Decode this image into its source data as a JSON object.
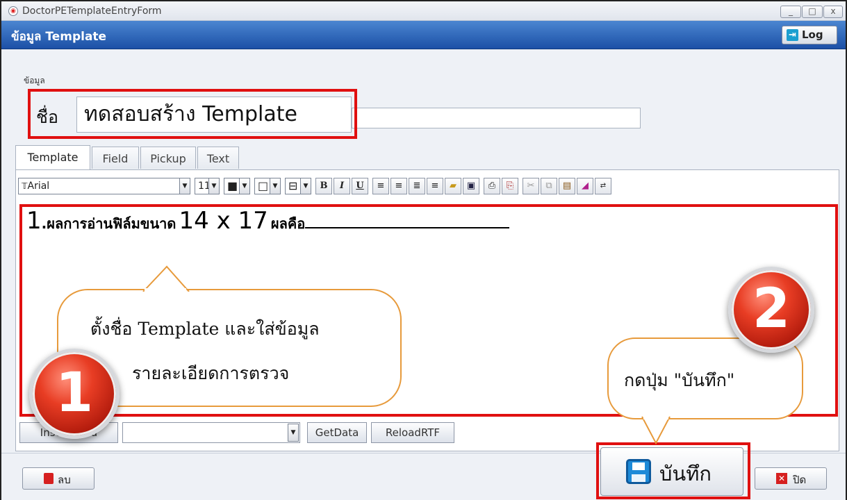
{
  "window": {
    "title": "DoctorPETemplateEntryForm",
    "controls": [
      "_",
      "□",
      "x"
    ]
  },
  "header": {
    "title": "ข้อมูล Template",
    "log_label": "Log"
  },
  "form": {
    "group_label": "ข้อมูล",
    "name_label": "ชื่อ",
    "name_value": "ทดสอบสร้าง Template"
  },
  "tabs": [
    {
      "label": "Template"
    },
    {
      "label": "Field"
    },
    {
      "label": "Pickup"
    },
    {
      "label": "Text"
    }
  ],
  "toolbar": {
    "font_name": "Arial",
    "font_size": "11",
    "bold": "B",
    "italic": "I",
    "underline": "U"
  },
  "editor": {
    "number": "1",
    "thai_1": ".ผลการอ่านฟิล์มขนาด",
    "size": "14 x 17",
    "thai_2": "ผลคือ"
  },
  "callouts": {
    "step1_line1": "ตั้งชื่อ Template และใส่ข้อมูล",
    "step1_line2": "รายละเอียดการตรวจ",
    "step2_text": "กดปุ่ม \"บันทึก\"",
    "badge1": "1",
    "badge2": "2"
  },
  "bottom_bar": {
    "insert_field": "Insert Field",
    "get_data": "GetData",
    "reload_rtf": "ReloadRTF"
  },
  "footer": {
    "delete_label": "ลบ",
    "save_label": "บันทึก",
    "close_label": "ปิด"
  },
  "colors": {
    "highlight": "#e01010",
    "header_blue": "#1c50a6",
    "callout_border": "#e79a3b",
    "badge_red": "#e83d24"
  }
}
